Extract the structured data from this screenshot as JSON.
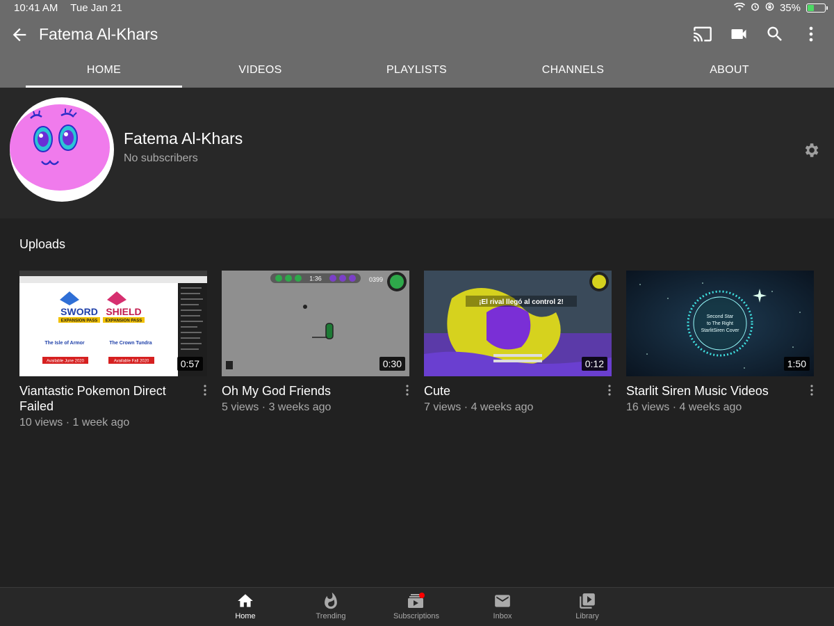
{
  "status_bar": {
    "time": "10:41 AM",
    "date": "Tue Jan 21",
    "battery": "35%"
  },
  "app_bar": {
    "title": "Fatema Al-Khars"
  },
  "tabs": [
    {
      "label": "HOME",
      "active": true
    },
    {
      "label": "VIDEOS"
    },
    {
      "label": "PLAYLISTS"
    },
    {
      "label": "CHANNELS"
    },
    {
      "label": "ABOUT"
    }
  ],
  "channel": {
    "name": "Fatema Al-Khars",
    "subscribers": "No subscribers"
  },
  "uploads": {
    "title": "Uploads",
    "videos": [
      {
        "title": "Viantastic Pokemon Direct Failed",
        "meta": "10 views · 1 week ago",
        "duration": "0:57"
      },
      {
        "title": "Oh My God Friends",
        "meta": "5 views · 3 weeks ago",
        "duration": "0:30"
      },
      {
        "title": "Cute",
        "meta": "7 views · 4 weeks ago",
        "duration": "0:12"
      },
      {
        "title": "Starlit Siren Music Videos",
        "meta": "16 views · 4 weeks ago",
        "duration": "1:50"
      }
    ]
  },
  "thumb_text": {
    "v1_edition_left": "SWORD",
    "v1_edition_right": "SHIELD",
    "v1_pack_left": "EXPANSION PASS",
    "v1_pack_right": "EXPANSION PASS",
    "v1_dlc_left": "The Isle of Armor",
    "v1_dlc_right": "The Crown Tundra",
    "v1_date_left": "Available June 2020",
    "v1_date_right": "Available Fall 2020",
    "v2_score": "0399",
    "v2_timer": "1:36",
    "v3_banner": "¡El rival llegó al control 2!",
    "v4_line1": "Second Star",
    "v4_line2": "to The Right",
    "v4_line3": "StarlitSiren Cover"
  },
  "bottom_nav": [
    {
      "label": "Home",
      "active": true
    },
    {
      "label": "Trending"
    },
    {
      "label": "Subscriptions"
    },
    {
      "label": "Inbox"
    },
    {
      "label": "Library"
    }
  ],
  "colors": {
    "bar": "#6b6b6b",
    "background": "#212121",
    "header": "#282828",
    "notification": "#ff0000"
  }
}
